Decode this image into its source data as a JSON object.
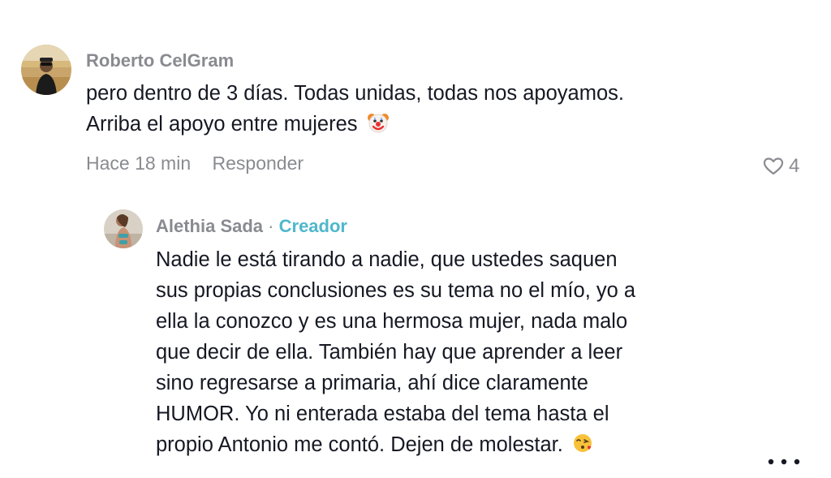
{
  "comment": {
    "username": "Roberto CelGram",
    "line1": "pero dentro de 3 días. Todas unidas, todas nos apoyamos.",
    "line2": "Arriba el apoyo entre mujeres",
    "emoji": "clown-face-emoji",
    "time": "Hace 18 min",
    "reply_label": "Responder",
    "like_count": "4"
  },
  "reply": {
    "username": "Alethia Sada",
    "separator": "·",
    "creator_label": "Creador",
    "lines": [
      "Nadie le está tirando a nadie, que ustedes saquen",
      "sus propias conclusiones es su tema no el mío, yo a",
      "ella la conozco y es una hermosa mujer, nada malo",
      "que decir de ella. También hay que aprender a leer",
      "sino regresarse a primaria, ahí dice claramente",
      "HUMOR. Yo ni enterada estaba del tema hasta el",
      "propio Antonio me contó. Dejen de molestar."
    ],
    "emoji": "face-blowing-kiss-emoji"
  },
  "icons": {
    "like": "heart-outline-icon",
    "more": "more-options-icon"
  }
}
